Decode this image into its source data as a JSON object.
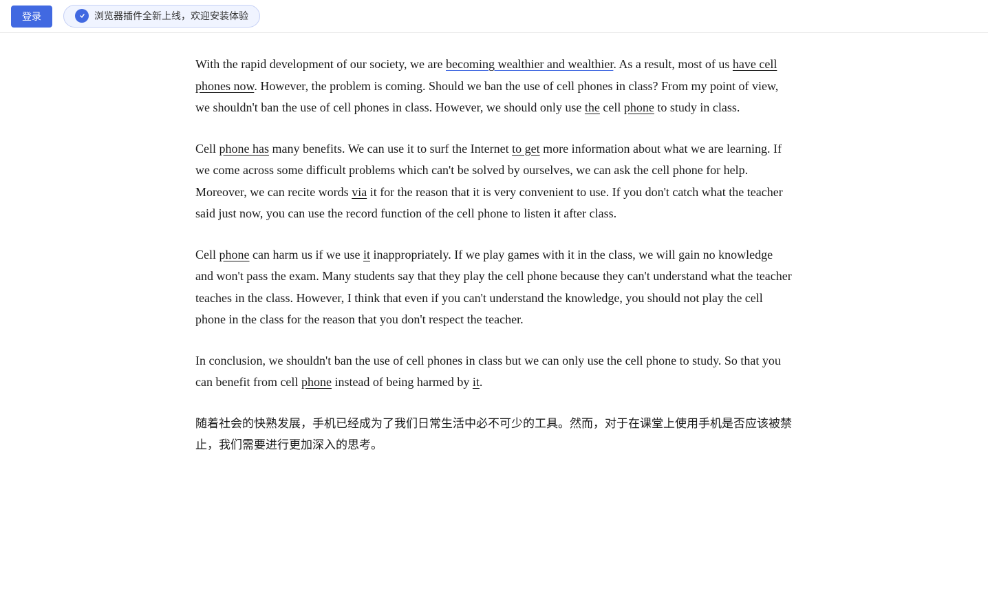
{
  "topbar": {
    "login_label": "登录",
    "plugin_notice": "浏览器插件全新上线，欢迎安装体验"
  },
  "content": {
    "paragraphs": [
      {
        "id": "p1",
        "type": "english",
        "text_raw": "With the rapid development of our society, we are becoming wealthier and wealthier. As a result, most of us have cell phones now. However, the problem is coming. Should we ban the use of cell phones in class? From my point of view, we shouldn't ban the use of cell phones in class. However, we should only use the cell phone to study in class."
      },
      {
        "id": "p2",
        "type": "english",
        "text_raw": "Cell phone has many benefits. We can use it to surf the Internet to get more information about what we are learning. If we come across some difficult problems which can't be solved by ourselves, we can ask the cell phone for help. Moreover, we can recite words via it for the reason that it is very convenient to use. If you don't catch what the teacher said just now, you can use the record function of the cell phone to listen it after class."
      },
      {
        "id": "p3",
        "type": "english",
        "text_raw": "Cell phone can harm us if we use it inappropriately. If we play games with it in the class, we will gain no knowledge and won't pass the exam. Many students say that they play the cell phone because they can't understand what the teacher teaches in the class. However, I think that even if you can't understand the knowledge, you should not play the cell phone in the class for the reason that you don't respect the teacher."
      },
      {
        "id": "p4",
        "type": "english",
        "text_raw": "In conclusion, we shouldn't ban the use of cell phones in class but we can only use the cell phone to study. So that you can benefit from cell phone instead of being harmed by it."
      },
      {
        "id": "p5",
        "type": "chinese",
        "text_raw": "随着社会的快熟发展，手机已经成为了我们日常生活中必不可少的工具。然而，对于在课堂上使用手机是否应该被禁止，我们需要进行更加深入的思考。"
      }
    ]
  }
}
